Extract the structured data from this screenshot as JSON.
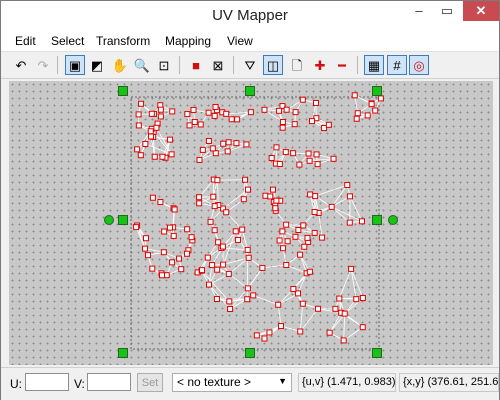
{
  "window": {
    "title": "UV Mapper",
    "controls": {
      "minimize": "–",
      "maximize": "▭",
      "close": "✕"
    }
  },
  "menu": [
    "Edit",
    "Select",
    "Transform",
    "Mapping",
    "View"
  ],
  "toolbar": [
    {
      "name": "undo-icon",
      "glyph": "↶",
      "active": false,
      "disabled": false
    },
    {
      "name": "redo-icon",
      "glyph": "↷",
      "active": false,
      "disabled": true
    },
    {
      "name": "select-vertices-icon",
      "glyph": "▣",
      "active": true,
      "disabled": false
    },
    {
      "name": "select-faces-icon",
      "glyph": "◩",
      "active": false,
      "disabled": false
    },
    {
      "name": "pan-hand-icon",
      "glyph": "✋",
      "active": false,
      "disabled": false
    },
    {
      "name": "zoom-icon",
      "glyph": "🔍",
      "active": false,
      "disabled": false
    },
    {
      "name": "zoom-fit-icon",
      "glyph": "⊡",
      "active": false,
      "disabled": false
    },
    {
      "name": "stop-icon",
      "glyph": "■",
      "active": false,
      "disabled": false,
      "color": "#d01010"
    },
    {
      "name": "clear-selection-icon",
      "glyph": "⊠",
      "active": false,
      "disabled": false
    },
    {
      "name": "filter-icon",
      "glyph": "⛛",
      "active": false,
      "disabled": false
    },
    {
      "name": "split-view-icon",
      "glyph": "◫",
      "active": true,
      "disabled": false
    },
    {
      "name": "page-icon",
      "glyph": "🗋",
      "active": false,
      "disabled": false
    },
    {
      "name": "add-icon",
      "glyph": "✚",
      "active": false,
      "disabled": false,
      "color": "#d01010"
    },
    {
      "name": "remove-icon",
      "glyph": "━",
      "active": false,
      "disabled": false,
      "color": "#d01010"
    },
    {
      "name": "grid-icon",
      "glyph": "▦",
      "active": true,
      "disabled": false
    },
    {
      "name": "snap-grid-icon",
      "glyph": "#",
      "active": true,
      "disabled": false
    },
    {
      "name": "target-icon",
      "glyph": "◎",
      "active": true,
      "disabled": false,
      "color": "#d01010"
    }
  ],
  "statusbar": {
    "u_label": "U:",
    "u_value": "",
    "v_label": "V:",
    "v_value": "",
    "set_label": "Set",
    "texture_selected": "< no texture >",
    "uv_readout": "{u,v} (1.471, 0.983)",
    "xy_readout": "{x,y} (376.61, 251.6"
  },
  "colors": {
    "canvas": "#c8c8c8",
    "vertex": "#e00000",
    "edge": "#ffffff",
    "handle_fill": "#19c119",
    "bounds": "#666666"
  }
}
